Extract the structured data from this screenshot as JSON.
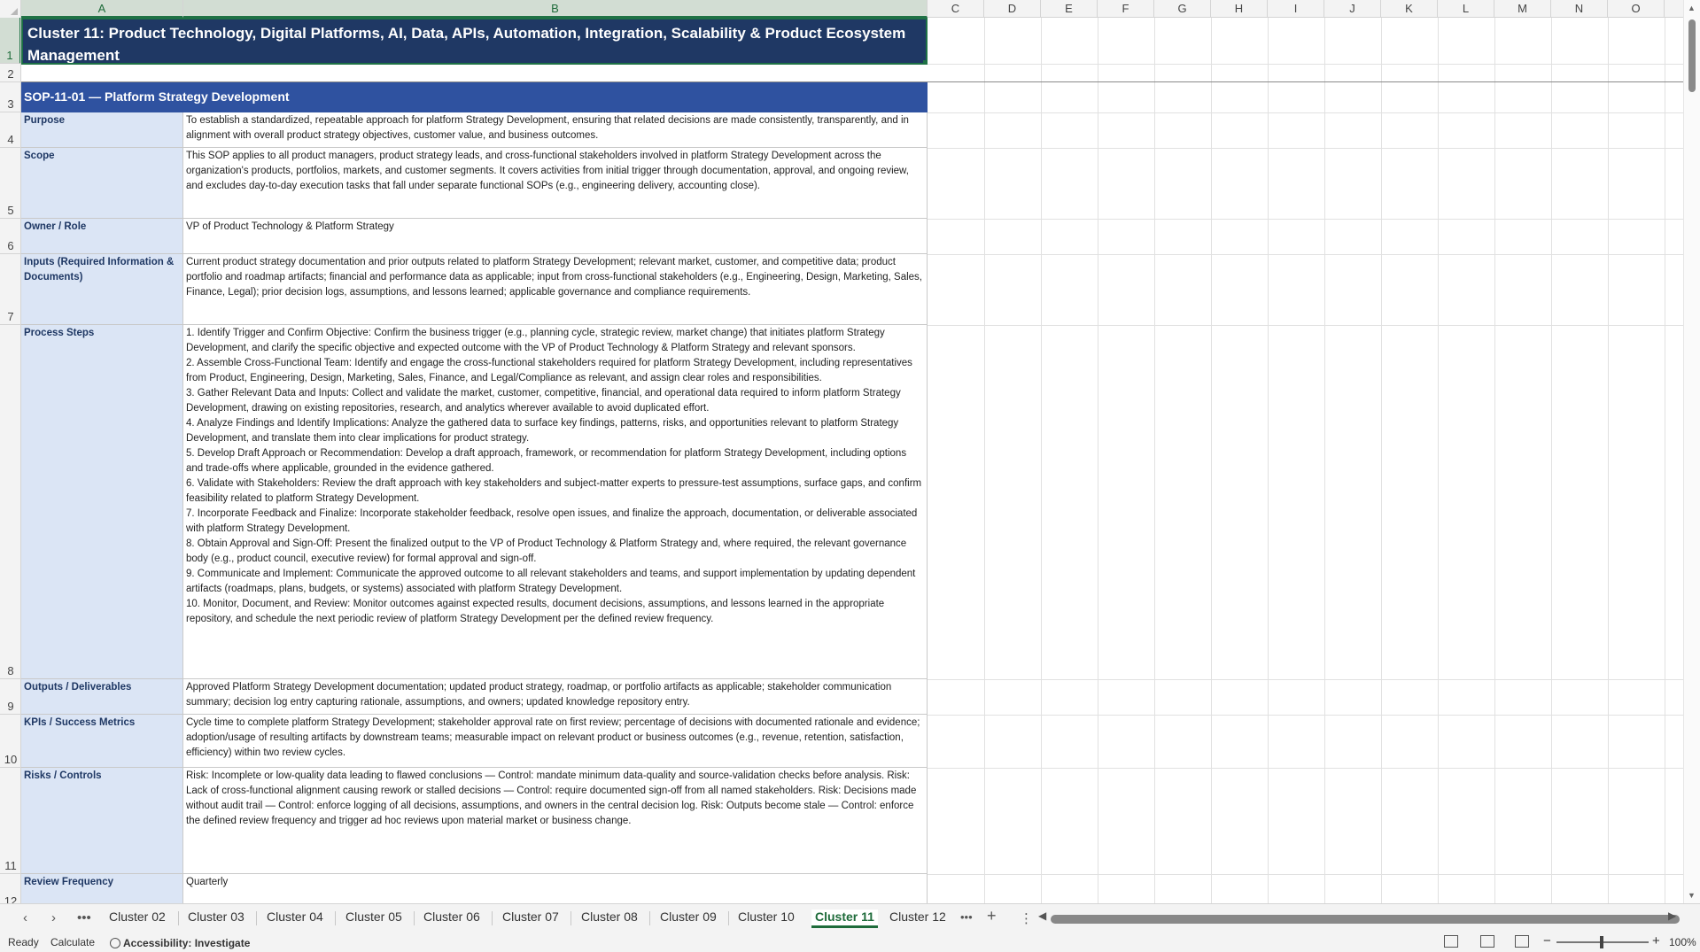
{
  "columns": [
    "A",
    "B",
    "C",
    "D",
    "E",
    "F",
    "G",
    "H",
    "I",
    "J",
    "K",
    "L",
    "M",
    "N",
    "O"
  ],
  "rows": [
    "1",
    "2",
    "3",
    "4",
    "5",
    "6",
    "7",
    "8",
    "9",
    "10",
    "11",
    "12"
  ],
  "title": "Cluster 11: Product Technology, Digital Platforms, AI, Data, APIs, Automation, Integration, Scalability & Product Ecosystem Management",
  "sop_header": "SOP-11-01 — Platform Strategy Development",
  "sections": [
    {
      "label": "Purpose",
      "value": "To establish a standardized, repeatable approach for platform Strategy Development, ensuring that related decisions are made consistently, transparently, and in alignment with overall product strategy objectives, customer value, and business outcomes."
    },
    {
      "label": "Scope",
      "value": "This SOP applies to all product managers, product strategy leads, and cross-functional stakeholders involved in platform Strategy Development across the organization's products, portfolios, markets, and customer segments. It covers activities from initial trigger through documentation, approval, and ongoing review, and excludes day-to-day execution tasks that fall under separate functional SOPs (e.g., engineering delivery, accounting close)."
    },
    {
      "label": "Owner / Role",
      "value": "VP of Product Technology & Platform Strategy"
    },
    {
      "label": "Inputs (Required Information & Documents)",
      "value": "Current product strategy documentation and prior outputs related to platform Strategy Development; relevant market, customer, and competitive data; product portfolio and roadmap artifacts; financial and performance data as applicable; input from cross-functional stakeholders (e.g., Engineering, Design, Marketing, Sales, Finance, Legal); prior decision logs, assumptions, and lessons learned; applicable governance and compliance requirements."
    },
    {
      "label": "Process Steps",
      "value": "1. Identify Trigger and Confirm Objective: Confirm the business trigger (e.g., planning cycle, strategic review, market change) that initiates platform Strategy Development, and clarify the specific objective and expected outcome with the VP of Product Technology & Platform Strategy and relevant sponsors.\n2. Assemble Cross-Functional Team: Identify and engage the cross-functional stakeholders required for platform Strategy Development, including representatives from Product, Engineering, Design, Marketing, Sales, Finance, and Legal/Compliance as relevant, and assign clear roles and responsibilities.\n3. Gather Relevant Data and Inputs: Collect and validate the market, customer, competitive, financial, and operational data required to inform platform Strategy Development, drawing on existing repositories, research, and analytics wherever available to avoid duplicated effort.\n4. Analyze Findings and Identify Implications: Analyze the gathered data to surface key findings, patterns, risks, and opportunities relevant to platform Strategy Development, and translate them into clear implications for product strategy.\n5. Develop Draft Approach or Recommendation: Develop a draft approach, framework, or recommendation for platform Strategy Development, including options and trade-offs where applicable, grounded in the evidence gathered.\n6. Validate with Stakeholders: Review the draft approach with key stakeholders and subject-matter experts to pressure-test assumptions, surface gaps, and confirm feasibility related to platform Strategy Development.\n7. Incorporate Feedback and Finalize: Incorporate stakeholder feedback, resolve open issues, and finalize the approach, documentation, or deliverable associated with platform Strategy Development.\n8. Obtain Approval and Sign-Off: Present the finalized output to the VP of Product Technology & Platform Strategy and, where required, the relevant governance body (e.g., product council, executive review) for formal approval and sign-off.\n9. Communicate and Implement: Communicate the approved outcome to all relevant stakeholders and teams, and support implementation by updating dependent artifacts (roadmaps, plans, budgets, or systems) associated with platform Strategy Development.\n10. Monitor, Document, and Review: Monitor outcomes against expected results, document decisions, assumptions, and lessons learned in the appropriate repository, and schedule the next periodic review of platform Strategy Development per the defined review frequency."
    },
    {
      "label": "Outputs / Deliverables",
      "value": "Approved Platform Strategy Development documentation; updated product strategy, roadmap, or portfolio artifacts as applicable; stakeholder communication summary; decision log entry capturing rationale, assumptions, and owners; updated knowledge repository entry."
    },
    {
      "label": "KPIs / Success Metrics",
      "value": "Cycle time to complete platform Strategy Development; stakeholder approval rate on first review; percentage of decisions with documented rationale and evidence; adoption/usage of resulting artifacts by downstream teams; measurable impact on relevant product or business outcomes (e.g., revenue, retention, satisfaction, efficiency) within two review cycles."
    },
    {
      "label": "Risks / Controls",
      "value": "Risk: Incomplete or low-quality data leading to flawed conclusions — Control: mandate minimum data-quality and source-validation checks before analysis. Risk: Lack of cross-functional alignment causing rework or stalled decisions — Control: require documented sign-off from all named stakeholders. Risk: Decisions made without audit trail — Control: enforce logging of all decisions, assumptions, and owners in the central decision log. Risk: Outputs become stale — Control: enforce the defined review frequency and trigger ad hoc reviews upon material market or business change."
    },
    {
      "label": "Review Frequency",
      "value": "Quarterly"
    }
  ],
  "tabs": [
    "Cluster 02",
    "Cluster 03",
    "Cluster 04",
    "Cluster 05",
    "Cluster 06",
    "Cluster 07",
    "Cluster 08",
    "Cluster 09",
    "Cluster 10",
    "Cluster 11",
    "Cluster 12"
  ],
  "active_tab": "Cluster 11",
  "status": {
    "ready": "Ready",
    "calculate": "Calculate",
    "accessibility": "Accessibility: Investigate",
    "zoom": "100%"
  },
  "colors": {
    "title_bg": "#1f3864",
    "sop_bg": "#2f52a0",
    "label_bg": "#dbe5f5",
    "accent": "#1e6b3a"
  }
}
